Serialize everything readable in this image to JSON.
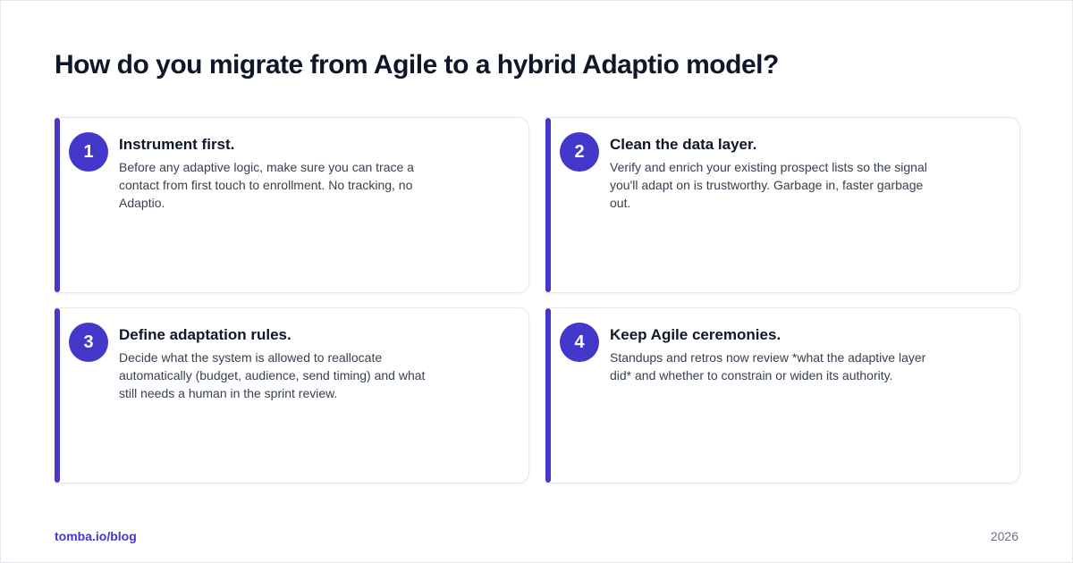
{
  "page": {
    "title": "How do you migrate from Agile to a hybrid Adaptio model?"
  },
  "steps": [
    {
      "number": "1",
      "title": "Instrument first.",
      "description": "Before any adaptive logic, make sure you can trace a contact from first touch to enrollment. No tracking, no Adaptio."
    },
    {
      "number": "2",
      "title": "Clean the data layer.",
      "description": "Verify and enrich your existing prospect lists so the signal you'll adapt on is trustworthy. Garbage in, faster garbage out."
    },
    {
      "number": "3",
      "title": "Define adaptation rules.",
      "description": "Decide what the system is allowed to reallocate automatically (budget, audience, send timing) and what still needs a human in the sprint review."
    },
    {
      "number": "4",
      "title": "Keep Agile ceremonies.",
      "description": "Standups and retros now review *what the adaptive layer did* and whether to constrain or widen its authority."
    }
  ],
  "footer": {
    "link": "tomba.io/blog",
    "year": "2026"
  },
  "colors": {
    "accent": "#4338ca",
    "title": "#0f172a",
    "body_text": "#374151",
    "muted": "#6b7280"
  }
}
